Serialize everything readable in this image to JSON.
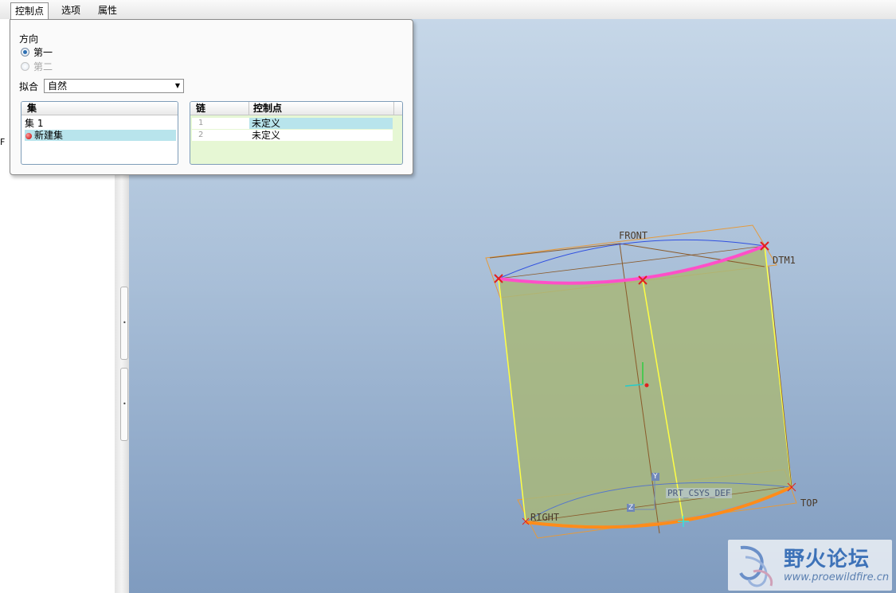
{
  "tabs": [
    {
      "label": "控制点",
      "active": true
    },
    {
      "label": "选项",
      "active": false
    },
    {
      "label": "属性",
      "active": false
    }
  ],
  "panel": {
    "direction_label": "方向",
    "direction_options": [
      {
        "label": "第一",
        "checked": true,
        "enabled": true
      },
      {
        "label": "第二",
        "checked": false,
        "enabled": false
      }
    ],
    "fit_label": "拟合",
    "fit_value": "自然",
    "sets": {
      "header": "集",
      "items": [
        "集 1",
        "新建集"
      ]
    },
    "chains": {
      "headers": [
        "链",
        "控制点"
      ],
      "rows": [
        {
          "index": "1",
          "control_point": "未定义"
        },
        {
          "index": "2",
          "control_point": "未定义"
        }
      ]
    }
  },
  "left_pane": {
    "truncated_text": "F"
  },
  "viewport": {
    "datum_labels": {
      "front": "FRONT",
      "dtm": "DTM1",
      "right": "RIGHT",
      "top": "TOP",
      "csys": "PRT_CSYS_DEF"
    },
    "axis_labels": {
      "y": "Y",
      "z": "Z"
    }
  },
  "watermark": {
    "title": "野火论坛",
    "url": "www.proewildfire.cn"
  },
  "colors": {
    "radio_checked": "#2d6fb3",
    "selection_row": "#b8e4ec",
    "chain_area": "#e6f7d4",
    "cylinder_fill": "#a8b77a",
    "top_curve": "#ff4fc8",
    "bottom_curve": "#ff8c1a",
    "datum_orange": "#e59a3c"
  }
}
